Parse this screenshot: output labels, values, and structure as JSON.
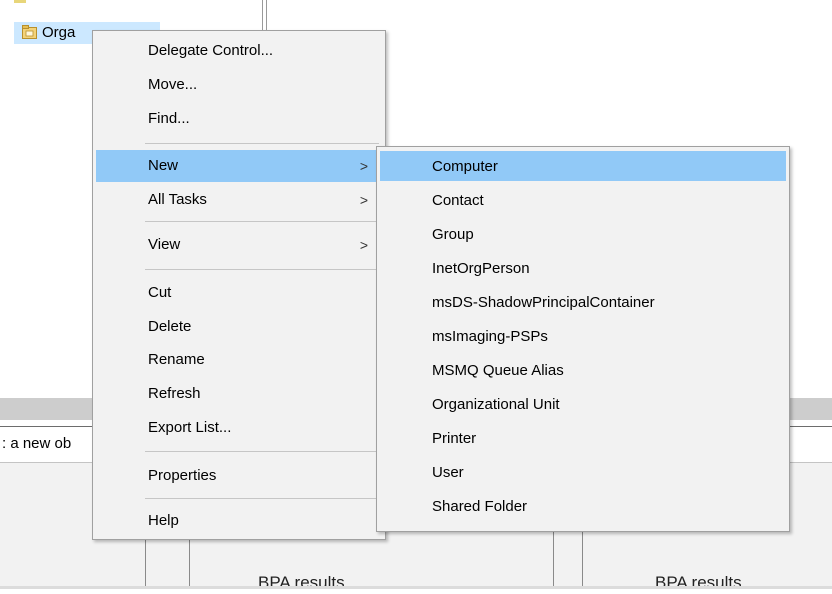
{
  "tree": {
    "item_label": "Orga"
  },
  "status": {
    "text": ": a new ob"
  },
  "bottom": {
    "bpa_left": "BPA results",
    "bpa_right": "BPA results"
  },
  "context_menu": {
    "items": [
      {
        "label": "Delegate Control..."
      },
      {
        "label": "Move..."
      },
      {
        "label": "Find..."
      },
      {
        "label": "New",
        "arrow": ">"
      },
      {
        "label": "All Tasks",
        "arrow": ">"
      },
      {
        "label": "View",
        "arrow": ">"
      },
      {
        "label": "Cut"
      },
      {
        "label": "Delete"
      },
      {
        "label": "Rename"
      },
      {
        "label": "Refresh"
      },
      {
        "label": "Export List..."
      },
      {
        "label": "Properties"
      },
      {
        "label": "Help"
      }
    ],
    "highlighted": "New"
  },
  "submenu": {
    "items": [
      {
        "label": "Computer"
      },
      {
        "label": "Contact"
      },
      {
        "label": "Group"
      },
      {
        "label": "InetOrgPerson"
      },
      {
        "label": "msDS-ShadowPrincipalContainer"
      },
      {
        "label": "msImaging-PSPs"
      },
      {
        "label": "MSMQ Queue Alias"
      },
      {
        "label": "Organizational Unit"
      },
      {
        "label": "Printer"
      },
      {
        "label": "User"
      },
      {
        "label": "Shared Folder"
      }
    ],
    "highlighted": "Computer"
  },
  "colors": {
    "highlight": "#91c9f7",
    "selection": "#cce8ff",
    "menu_bg": "#f2f2f2"
  },
  "icons": {
    "tree_item": "folder-icon"
  }
}
